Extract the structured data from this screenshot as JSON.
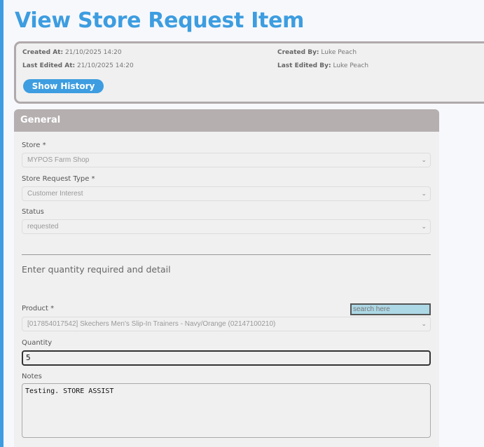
{
  "page": {
    "title": "View Store Request Item"
  },
  "info": {
    "created_at_label": "Created At:",
    "created_at": "21/10/2025 14:20",
    "created_by_label": "Created By:",
    "created_by": "Luke Peach",
    "last_edited_at_label": "Last Edited At:",
    "last_edited_at": "21/10/2025 14:20",
    "last_edited_by_label": "Last Edited By:",
    "last_edited_by": "Luke Peach",
    "show_history": "Show History"
  },
  "general": {
    "header": "General",
    "store_label": "Store *",
    "store_value": "MYPOS Farm Shop",
    "type_label": "Store Request Type *",
    "type_value": "Customer Interest",
    "status_label": "Status",
    "status_value": "requested",
    "subheading": "Enter quantity required and detail",
    "product_label": "Product *",
    "search_placeholder": "search here",
    "product_value": "[017854017542] Skechers Men's Slip-In Trainers - Navy/Orange (02147100210)",
    "quantity_label": "Quantity",
    "quantity_value": "5",
    "notes_label": "Notes",
    "notes_value": "Testing. STORE ASSIST"
  },
  "colors": {
    "accent": "#3d9de0",
    "panel_header": "#b5afb0",
    "search_bg": "#add8e6"
  }
}
